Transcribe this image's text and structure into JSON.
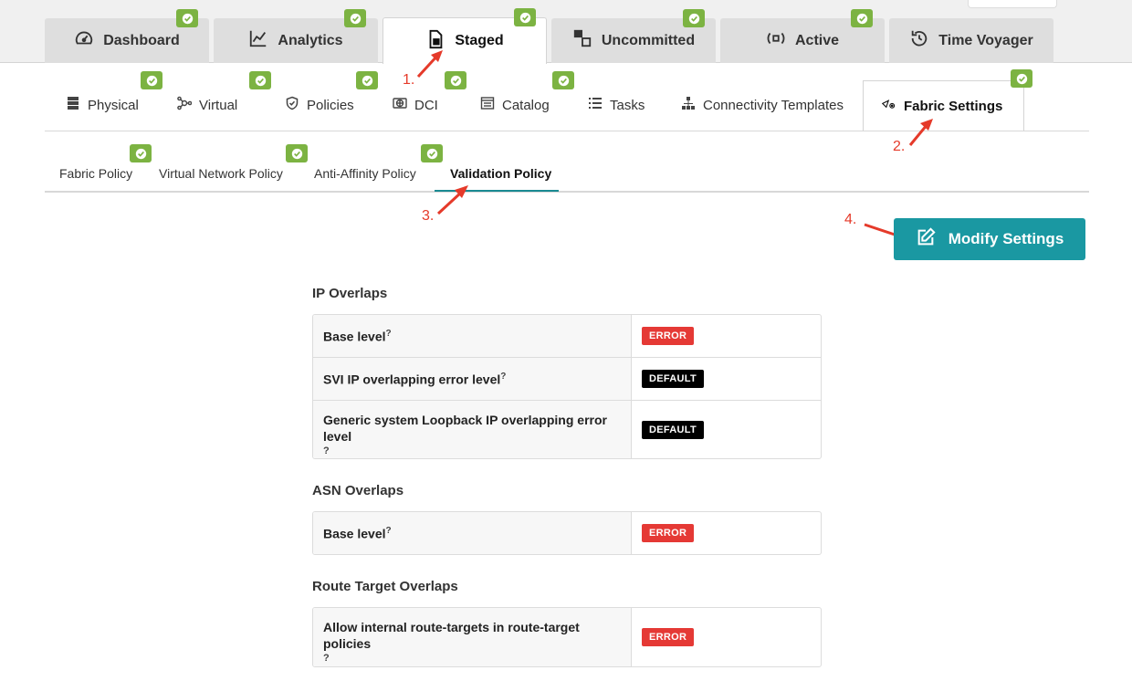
{
  "main_tabs": [
    {
      "label": "Dashboard",
      "icon": "gauge-icon"
    },
    {
      "label": "Analytics",
      "icon": "line-chart-icon"
    },
    {
      "label": "Staged",
      "icon": "staged-file-icon",
      "active": true
    },
    {
      "label": "Uncommitted",
      "icon": "uncommitted-icon"
    },
    {
      "label": "Active",
      "icon": "active-signal-icon"
    },
    {
      "label": "Time Voyager",
      "icon": "history-icon"
    }
  ],
  "sub_tabs": [
    {
      "label": "Physical",
      "icon": "server-icon"
    },
    {
      "label": "Virtual",
      "icon": "network-nodes-icon"
    },
    {
      "label": "Policies",
      "icon": "shield-icon"
    },
    {
      "label": "DCI",
      "icon": "globe-icon"
    },
    {
      "label": "Catalog",
      "icon": "catalog-icon"
    },
    {
      "label": "Tasks",
      "icon": "list-icon"
    },
    {
      "label": "Connectivity Templates",
      "icon": "hierarchy-icon"
    },
    {
      "label": "Fabric Settings",
      "icon": "fabric-settings-icon",
      "active": true
    }
  ],
  "third_tabs": [
    {
      "label": "Fabric Policy"
    },
    {
      "label": "Virtual Network Policy"
    },
    {
      "label": "Anti-Affinity Policy"
    },
    {
      "label": "Validation Policy",
      "active": true
    }
  ],
  "steps": {
    "s1": "1.",
    "s2": "2.",
    "s3": "3.",
    "s4": "4."
  },
  "modify_button": {
    "label": "Modify Settings"
  },
  "help_glyph": "?",
  "sections": {
    "ip_overlaps": {
      "title": "IP Overlaps",
      "rows": [
        {
          "label": "Base level",
          "value": "ERROR"
        },
        {
          "label": "SVI IP overlapping error level",
          "value": "DEFAULT"
        },
        {
          "label": "Generic system Loopback IP overlapping error level",
          "value": "DEFAULT"
        }
      ]
    },
    "asn_overlaps": {
      "title": "ASN Overlaps",
      "rows": [
        {
          "label": "Base level",
          "value": "ERROR"
        }
      ]
    },
    "route_target_overlaps": {
      "title": "Route Target Overlaps",
      "rows": [
        {
          "label": "Allow internal route-targets in route-target policies",
          "value": "ERROR"
        }
      ]
    }
  },
  "colors": {
    "accent": "#1a98a2",
    "badge_green": "#7cb342",
    "error_red": "#e53935",
    "default_black": "#000000",
    "annotation_red": "#e53a2a"
  }
}
